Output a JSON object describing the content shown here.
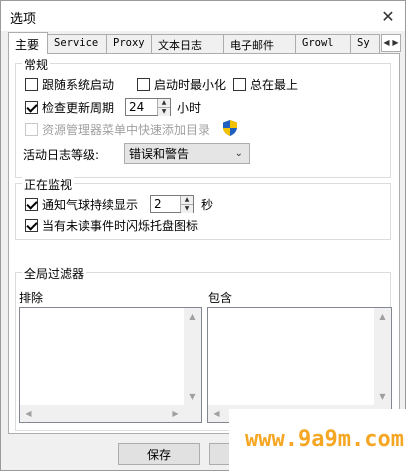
{
  "window": {
    "title": "选项",
    "close_glyph": "✕"
  },
  "tabs": [
    {
      "label": "主要",
      "active": true
    },
    {
      "label": "Service"
    },
    {
      "label": "Proxy"
    },
    {
      "label": "文本日志"
    },
    {
      "label": "电子邮件"
    },
    {
      "label": "Growl"
    },
    {
      "label": "Sy"
    }
  ],
  "tab_scroll": {
    "left": "◀",
    "right": "▶"
  },
  "general": {
    "title": "常规",
    "start_with_system": {
      "label": "跟随系统启动",
      "checked": false
    },
    "start_minimized": {
      "label": "启动时最小化",
      "checked": false
    },
    "always_on_top": {
      "label": "总在最上",
      "checked": false
    },
    "check_updates": {
      "label": "检查更新周期",
      "checked": true,
      "value": "24",
      "unit": "小时"
    },
    "explorer_menu": {
      "label": "资源管理器菜单中快速添加目录",
      "checked": false,
      "disabled": true
    },
    "log_level": {
      "label": "活动日志等级:",
      "value": "错误和警告"
    }
  },
  "monitoring": {
    "title": "正在监视",
    "balloon": {
      "label": "通知气球持续显示",
      "checked": true,
      "value": "2",
      "unit": "秒"
    },
    "flash_tray": {
      "label": "当有未读事件时闪烁托盘图标",
      "checked": true
    }
  },
  "filters": {
    "title": "全局过滤器",
    "exclude_label": "排除",
    "include_label": "包含"
  },
  "buttons": {
    "save": "保存",
    "cancel": "取"
  },
  "watermark": "www.9a9m.com",
  "colors": {
    "watermark": "#f5a623",
    "shield_blue": "#1f5fbf",
    "shield_yellow": "#f2c200"
  }
}
